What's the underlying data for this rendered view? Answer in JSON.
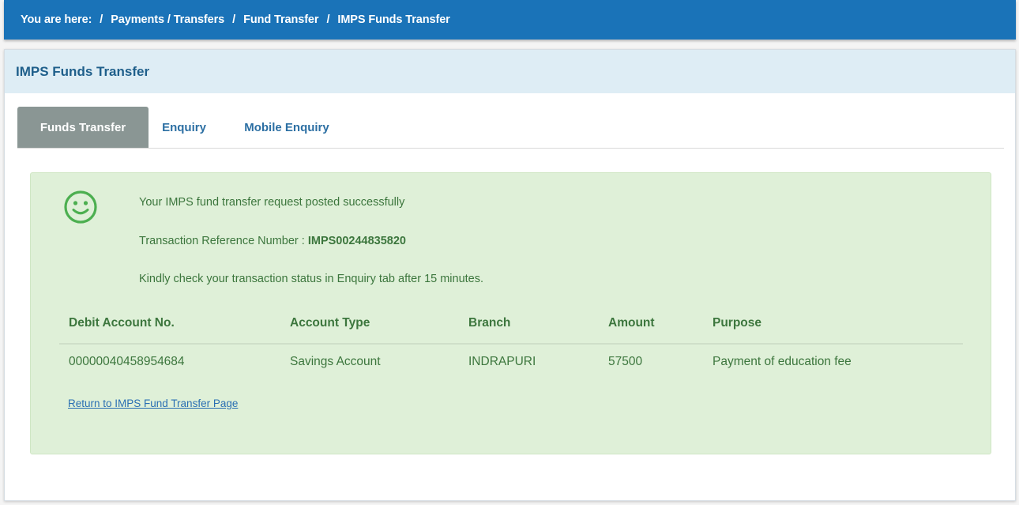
{
  "breadcrumb": {
    "prefix": "You are here:",
    "items": [
      "Payments / Transfers",
      "Fund Transfer",
      "IMPS Funds Transfer"
    ],
    "separator": "/"
  },
  "panel": {
    "title": "IMPS Funds Transfer"
  },
  "tabs": [
    {
      "label": "Funds Transfer",
      "active": true
    },
    {
      "label": "Enquiry",
      "active": false
    },
    {
      "label": "Mobile Enquiry",
      "active": false
    }
  ],
  "success": {
    "icon": "smiley-icon",
    "message": "Your IMPS fund transfer request posted successfully",
    "reference_label": "Transaction Reference Number :",
    "reference_value": "IMPS00244835820",
    "note": "Kindly check your transaction status in Enquiry tab after 15 minutes."
  },
  "table": {
    "headers": [
      "Debit Account No.",
      "Account Type",
      "Branch",
      "Amount",
      "Purpose"
    ],
    "rows": [
      [
        "00000040458954684",
        "Savings Account",
        "INDRAPURI",
        "57500",
        "Payment of education fee"
      ]
    ]
  },
  "return_link": "Return to IMPS Fund Transfer Page",
  "colors": {
    "breadcrumb_bg": "#1a73b8",
    "panel_header_bg": "#deedf5",
    "success_bg": "#dff0d8",
    "success_text": "#3c763d",
    "active_tab_bg": "#8a9694",
    "smiley": "#4caf50"
  }
}
